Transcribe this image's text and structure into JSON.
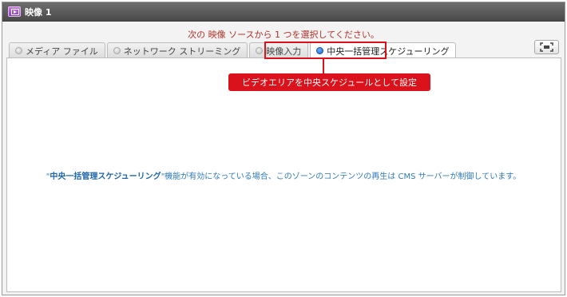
{
  "window": {
    "title": "映像 1"
  },
  "instruction": "次の 映像 ソースから 1 つを選択してください。",
  "tabs": [
    {
      "label": "メディア ファイル",
      "selected": false
    },
    {
      "label": "ネットワーク ストリーミング",
      "selected": false
    },
    {
      "label": "映像入力",
      "selected": false
    },
    {
      "label": "中央一括管理スケジューリング",
      "selected": true
    }
  ],
  "callout": "ビデオエリアを中央スケジュールとして設定",
  "message": {
    "open_quote": "\"",
    "feature_name": "中央一括管理スケジューリング",
    "close_quote": "\"",
    "body": "機能が有効になっている場合、このゾーンのコンテンツの再生は CMS サーバーが制御しています。"
  },
  "icons": {
    "title": "video-window-icon",
    "tool": "screen-capture-icon"
  },
  "colors": {
    "titlebar": "#4a4a4a",
    "instruction": "#b0322a",
    "highlight": "#d9121b",
    "message": "#2f7ab8",
    "radio_selected": "#1a62c8"
  }
}
